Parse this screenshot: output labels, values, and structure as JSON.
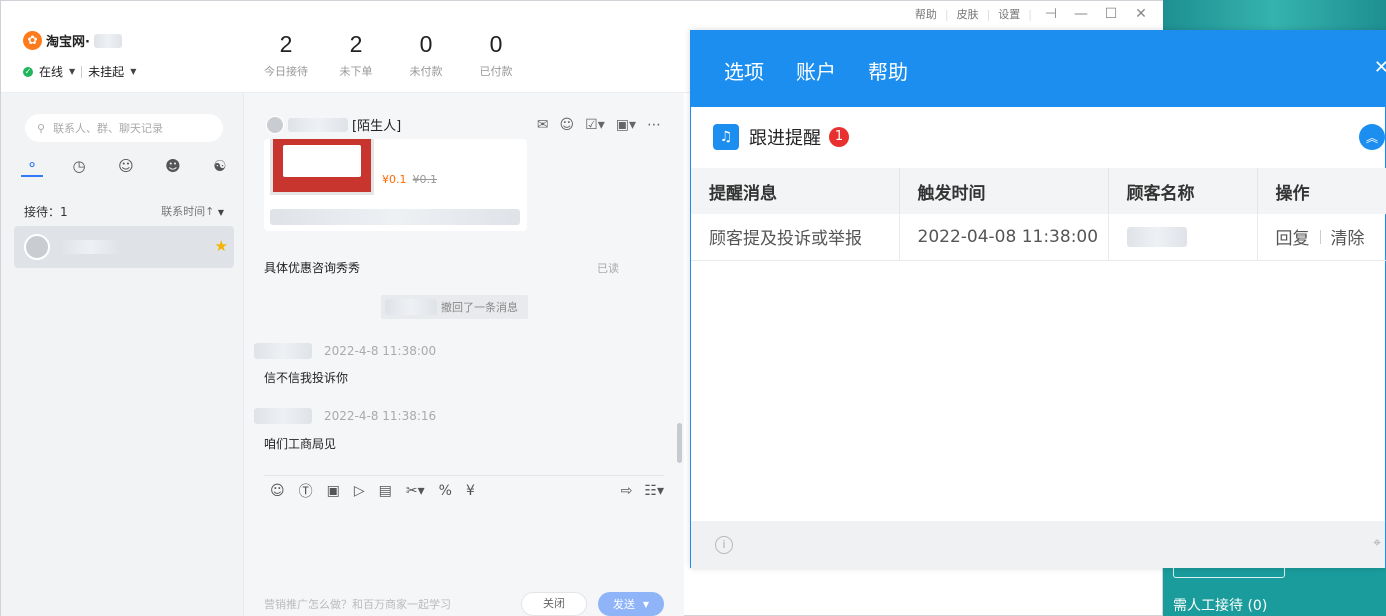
{
  "app": {
    "brand": "淘宝网·",
    "status": "在线",
    "hang": "未挂起",
    "stats": [
      {
        "value": "2",
        "label": "今日接待"
      },
      {
        "value": "2",
        "label": "未下单"
      },
      {
        "value": "0",
        "label": "未付款"
      },
      {
        "value": "0",
        "label": "已付款"
      }
    ],
    "win_links": {
      "help": "帮助",
      "skin": "皮肤",
      "settings": "设置"
    }
  },
  "contacts": {
    "search_placeholder": "联系人、群、聊天记录",
    "reception": "接待：1",
    "sort": "联系时间↑"
  },
  "chat": {
    "title_tag": "[陌生人]",
    "card_price": "¥0.1",
    "card_old_price": "¥0.1",
    "msg_1": "具体优惠咨询秀秀",
    "read": "已读",
    "recall": "撤回了一条消息",
    "time_2": "2022-4-8 11:38:00",
    "msg_2": "信不信我投诉你",
    "time_3": "2022-4-8 11:38:16",
    "msg_3": "咱们工商局见",
    "bottom_tip": "营销推广怎么做？和百万商家一起学习",
    "close": "关闭",
    "send": "发送"
  },
  "right_strip": {
    "text": "需人工接待 (0)"
  },
  "dialog": {
    "menu": [
      "选项",
      "账户",
      "帮助"
    ],
    "reminder_title": "跟进提醒",
    "reminder_count": "1",
    "columns": [
      "提醒消息",
      "触发时间",
      "顾客名称",
      "操作"
    ],
    "row": {
      "message": "顾客提及投诉或举报",
      "time": "2022-04-08 11:38:00",
      "reply": "回复",
      "clear": "清除"
    }
  },
  "colors": {
    "accent": "#1b8ef0",
    "badge": "#e8302f",
    "online": "#21b45a",
    "price": "#ff6a00"
  }
}
